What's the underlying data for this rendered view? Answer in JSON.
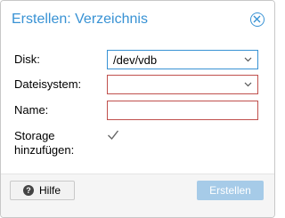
{
  "dialog": {
    "title": "Erstellen: Verzeichnis",
    "close_icon": "close-circle-icon"
  },
  "form": {
    "disk": {
      "label": "Disk:",
      "value": "/dev/vdb"
    },
    "filesystem": {
      "label": "Dateisystem:",
      "value": ""
    },
    "name": {
      "label": "Name:",
      "value": ""
    },
    "storage": {
      "label_line1": "Storage",
      "label_line2": "hinzufügen:",
      "checked": true
    }
  },
  "footer": {
    "help_label": "Hilfe",
    "help_icon": "question-circle-icon",
    "create_label": "Erstellen"
  },
  "colors": {
    "accent": "#3892d4",
    "error": "#c0504d",
    "disabled_button": "#a6cbe8"
  }
}
